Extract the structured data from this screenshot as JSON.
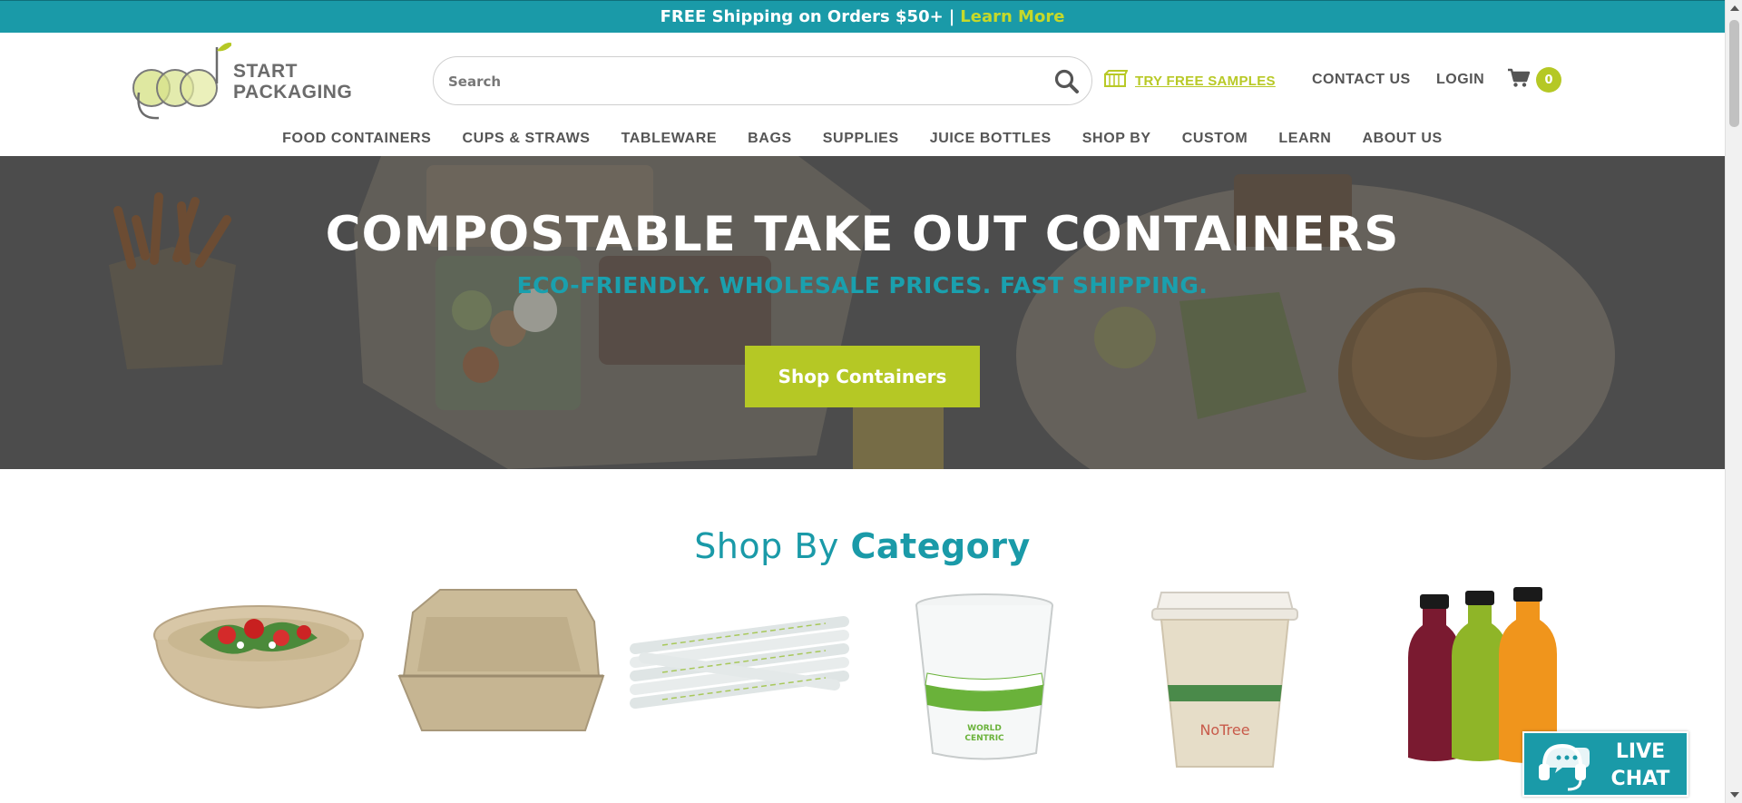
{
  "promo": {
    "text": "FREE Shipping on Orders $50+",
    "separator": "|",
    "link_label": "Learn More"
  },
  "header": {
    "logo_line1": "START",
    "logo_line2": "PACKAGING",
    "search_placeholder": "Search",
    "samples_label": "TRY FREE SAMPLES",
    "contact_label": "CONTACT US",
    "login_label": "LOGIN",
    "cart_count": "0"
  },
  "nav": {
    "items": [
      "FOOD CONTAINERS",
      "CUPS & STRAWS",
      "TABLEWARE",
      "BAGS",
      "SUPPLIES",
      "JUICE BOTTLES",
      "SHOP BY",
      "CUSTOM",
      "LEARN",
      "ABOUT US"
    ]
  },
  "hero": {
    "title": "COMPOSTABLE TAKE OUT CONTAINERS",
    "subtitle": "ECO-FRIENDLY. WHOLESALE PRICES. FAST SHIPPING.",
    "cta_label": "Shop Containers"
  },
  "category": {
    "title_light": "Shop By",
    "title_bold": "Category",
    "items": [
      {
        "icon": "salad-bowl-icon"
      },
      {
        "icon": "clamshell-container-icon"
      },
      {
        "icon": "wrapped-straws-icon"
      },
      {
        "icon": "clear-cup-icon"
      },
      {
        "icon": "hot-cup-icon"
      },
      {
        "icon": "juice-bottles-icon"
      }
    ]
  },
  "live_chat": {
    "line1": "LIVE",
    "line2": "CHAT"
  },
  "colors": {
    "teal": "#1a9aa8",
    "lime": "#b5c825",
    "text_gray": "#555555"
  }
}
